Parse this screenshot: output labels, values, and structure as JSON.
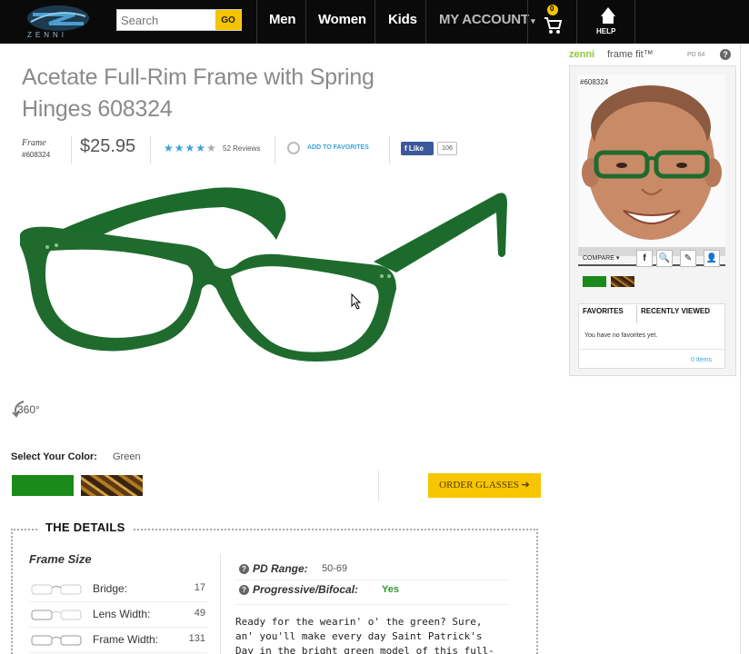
{
  "header": {
    "logo_text": "ZENNI",
    "search": {
      "placeholder": "Search",
      "go_label": "GO"
    },
    "nav": [
      {
        "label": "Men"
      },
      {
        "label": "Women"
      },
      {
        "label": "Kids"
      },
      {
        "label": "MY ACCOUNT"
      }
    ],
    "cart_count": "0",
    "help_label": "HELP"
  },
  "product": {
    "title_line1": "Acetate Full-Rim Frame with Spring",
    "title_line2": "Hinges 608324",
    "frame_label": "Frame",
    "sku": "#608324",
    "price": "$25.95",
    "rating": 4,
    "stars_on": "★★★★",
    "stars_off": "★",
    "reviews": "52 Reviews",
    "add_favorites": "ADD TO FAVORITES",
    "fb_like": "Like",
    "fb_count": "106",
    "rotate_label": "360°",
    "frame_color": "#1f6b2e"
  },
  "color_select": {
    "label": "Select Your Color:",
    "value": "Green",
    "swatches": [
      "green",
      "tortoise"
    ],
    "order_button": "ORDER GLASSES ➔"
  },
  "details": {
    "title": "THE DETAILS",
    "frame_size_title": "Frame Size",
    "sizes": [
      {
        "label": "Bridge:",
        "value": "17"
      },
      {
        "label": "Lens Width:",
        "value": "49"
      },
      {
        "label": "Frame Width:",
        "value": "131"
      }
    ],
    "pd_range_label": "PD Range:",
    "pd_range_value": "50-69",
    "progressive_label": "Progressive/Bifocal:",
    "progressive_value": "Yes",
    "description_lines": [
      "Ready for the wearin' o' the green? Sure,",
      "an' you'll make every day Saint Patrick's",
      "Day in the bright green model of this full-"
    ]
  },
  "frame_fit": {
    "brand": "zenni",
    "product": "frame fit™",
    "pd": "PD 64",
    "sku": "#608324",
    "compare_label": "COMPARE ▾",
    "tools": [
      "f",
      "🔍",
      "✎",
      "👤"
    ],
    "tabs": {
      "favorites": "FAVORITES",
      "recent": "RECENTLY VIEWED"
    },
    "empty_text": "You have no favorites yet.",
    "items_link": "0 Items"
  },
  "colors": {
    "nav_bg": "#0a0a0a",
    "accent_yellow": "#f7c600",
    "link_blue": "#3ba3d9",
    "frame_green": "#1f6b2e"
  }
}
